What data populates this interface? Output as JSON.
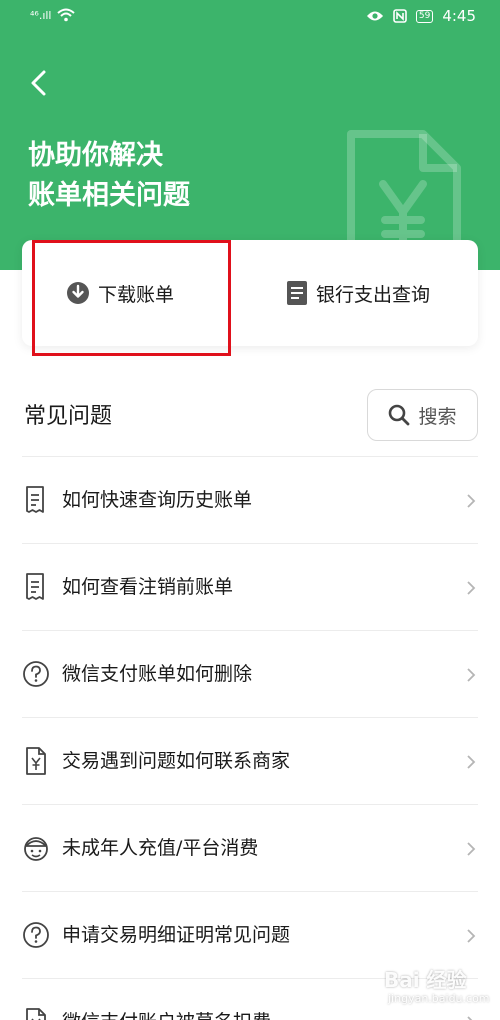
{
  "status_bar": {
    "signal": "⁴⁶.ıll",
    "battery": "59",
    "time": "4:45"
  },
  "header": {
    "title_line1": "协助你解决",
    "title_line2": "账单相关问题"
  },
  "actions": {
    "download": "下载账单",
    "bank_query": "银行支出查询"
  },
  "faq": {
    "title": "常见问题",
    "search_label": "搜索",
    "items": [
      {
        "label": "如何快速查询历史账单",
        "icon": "receipt-icon"
      },
      {
        "label": "如何查看注销前账单",
        "icon": "receipt-icon"
      },
      {
        "label": "微信支付账单如何删除",
        "icon": "question-icon"
      },
      {
        "label": "交易遇到问题如何联系商家",
        "icon": "yuan-doc-icon"
      },
      {
        "label": "未成年人充值/平台消费",
        "icon": "child-face-icon"
      },
      {
        "label": "申请交易明细证明常见问题",
        "icon": "question-icon"
      },
      {
        "label": "微信支付账户被莫名扣费",
        "icon": "yuan-doc-icon"
      }
    ]
  },
  "watermark": {
    "brand": "Bai 经验",
    "url": "jingyan.baidu.com"
  },
  "colors": {
    "brand_green": "#3cb46b",
    "highlight_red": "#e0101b"
  }
}
